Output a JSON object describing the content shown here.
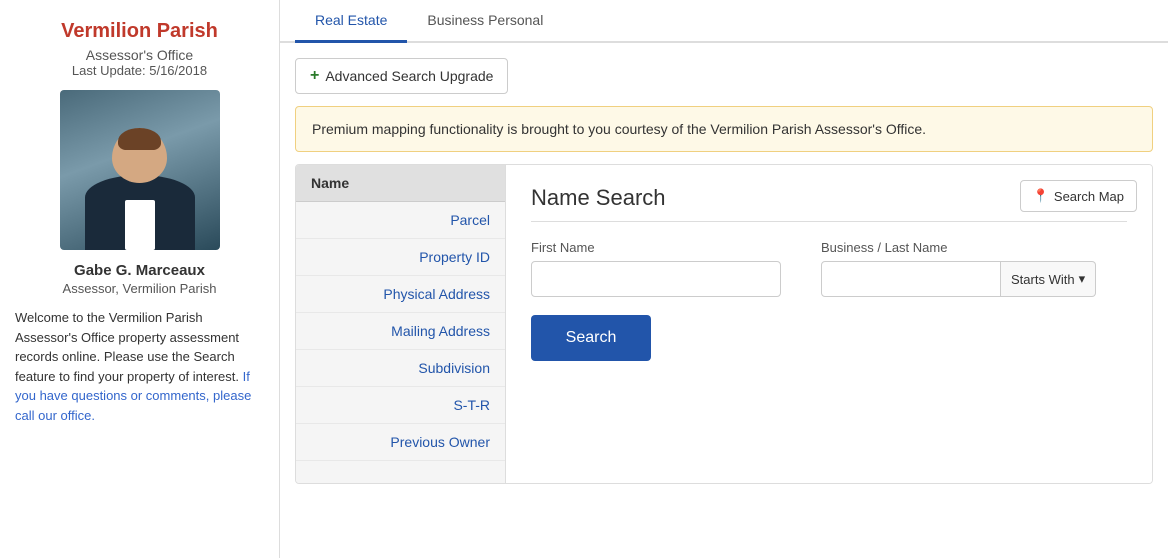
{
  "sidebar": {
    "title": "Vermilion Parish",
    "office": "Assessor's Office",
    "last_update_label": "Last Update: 5/16/2018",
    "assessor_name": "Gabe G. Marceaux",
    "assessor_role": "Assessor, Vermilion Parish",
    "description_1": "Welcome to the Vermilion Parish Assessor's Office property assessment records online. Please use the Search feature to find your property of interest.",
    "description_link_text": "If you have questions or comments, please call our office.",
    "description_link": "#"
  },
  "tabs": [
    {
      "label": "Real Estate",
      "active": true
    },
    {
      "label": "Business Personal",
      "active": false
    }
  ],
  "advanced_search": {
    "button_label": "Advanced Search Upgrade",
    "plus_symbol": "+"
  },
  "notice": {
    "text": "Premium mapping functionality is brought to you courtesy of the Vermilion Parish Assessor's Office."
  },
  "search_nav": {
    "header": "Name",
    "items": [
      {
        "label": "Parcel"
      },
      {
        "label": "Property ID"
      },
      {
        "label": "Physical Address"
      },
      {
        "label": "Mailing Address"
      },
      {
        "label": "Subdivision"
      },
      {
        "label": "S-T-R"
      },
      {
        "label": "Previous Owner"
      }
    ]
  },
  "search_map_btn": {
    "label": "Search Map",
    "pin_symbol": "📍"
  },
  "name_search": {
    "title": "Name Search",
    "first_name_label": "First Name",
    "first_name_placeholder": "",
    "last_name_label": "Business / Last Name",
    "last_name_placeholder": "",
    "dropdown_label": "Starts With",
    "dropdown_icon": "▾",
    "search_button_label": "Search"
  }
}
